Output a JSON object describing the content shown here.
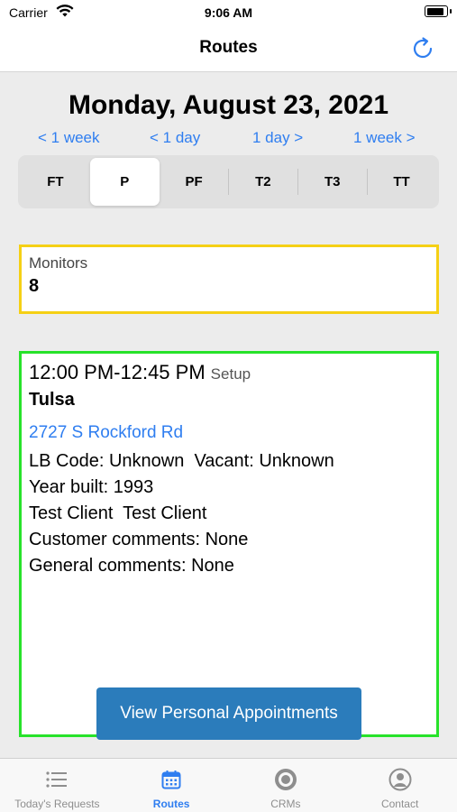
{
  "status_bar": {
    "carrier": "Carrier",
    "time": "9:06 AM",
    "battery_level": 0.9
  },
  "nav": {
    "title": "Routes",
    "refresh_icon": "refresh-icon"
  },
  "date": {
    "title": "Monday, August 23, 2021"
  },
  "jumps": {
    "back_week": "< 1 week",
    "back_day": "< 1 day",
    "forward_day": "1 day >",
    "forward_week": "1 week >"
  },
  "segments": {
    "items": [
      "FT",
      "P",
      "PF",
      "T2",
      "T3",
      "TT"
    ],
    "selected": "P"
  },
  "monitors": {
    "label": "Monitors",
    "value": "8"
  },
  "appointment": {
    "time": "12:00 PM-12:45 PM",
    "kind": "Setup",
    "city": "Tulsa",
    "address": "2727 S Rockford Rd",
    "codes_line": "LB Code: Unknown  Vacant: Unknown",
    "year_line": "Year built: 1993",
    "client_line": "Test Client  Test Client",
    "customer_comments": "Customer comments: None",
    "general_comments": "General comments: None"
  },
  "personal_button": {
    "label": "View Personal Appointments"
  },
  "tabs": [
    {
      "label": "Today's Requests",
      "icon": "list-icon"
    },
    {
      "label": "Routes",
      "icon": "calendar-icon"
    },
    {
      "label": "CRMs",
      "icon": "target-icon"
    },
    {
      "label": "Contact",
      "icon": "person-icon"
    }
  ],
  "colors": {
    "accent": "#2f7ef0",
    "monitors_border": "#f5d015",
    "appointment_border": "#27e22a",
    "button": "#2b7cbb"
  }
}
